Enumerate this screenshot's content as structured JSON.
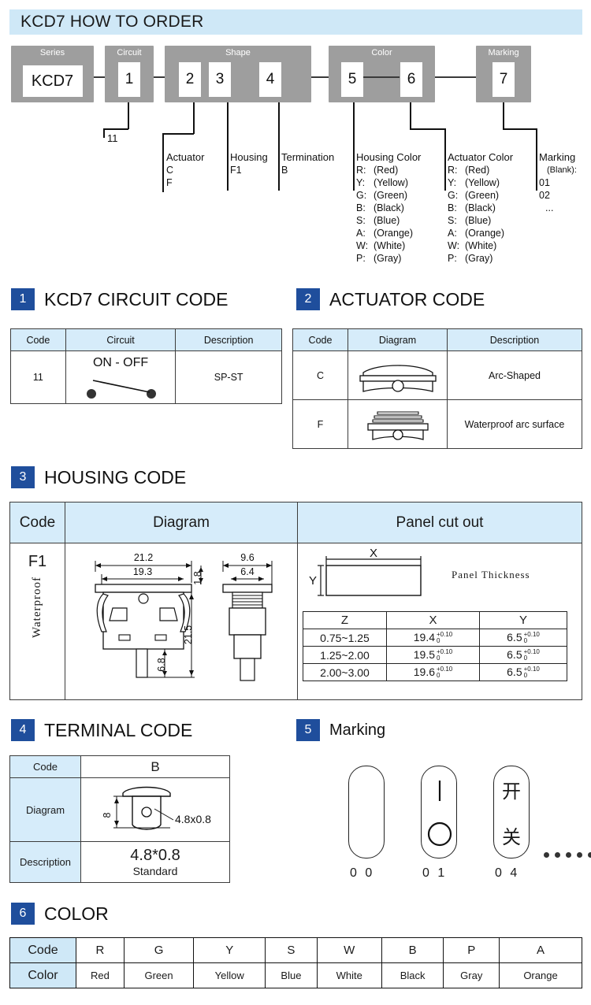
{
  "header": {
    "title": "KCD7 HOW TO ORDER"
  },
  "order_diagram": {
    "groups": [
      {
        "label": "Series",
        "cells": [
          "KCD7"
        ]
      },
      {
        "label": "Circuit",
        "cells": [
          "1"
        ]
      },
      {
        "label": "Shape",
        "cells": [
          "2",
          "3",
          "4"
        ]
      },
      {
        "label": "Color",
        "cells": [
          "5",
          "6"
        ]
      },
      {
        "label": "Marking",
        "cells": [
          "7"
        ]
      }
    ]
  },
  "legend": {
    "circuit": {
      "title": "",
      "value": "11"
    },
    "actuator": {
      "title": "Actuator",
      "items": [
        "C",
        "F"
      ]
    },
    "housing": {
      "title": "Housing",
      "items": [
        "F1"
      ]
    },
    "termination": {
      "title": "Termination",
      "items": [
        "B"
      ]
    },
    "housing_color": {
      "title": "Housing Color",
      "items": [
        {
          "code": "R:",
          "name": "(Red)"
        },
        {
          "code": "Y:",
          "name": "(Yellow)"
        },
        {
          "code": "G:",
          "name": "(Green)"
        },
        {
          "code": "B:",
          "name": "(Black)"
        },
        {
          "code": "S:",
          "name": "(Blue)"
        },
        {
          "code": "A:",
          "name": "(Orange)"
        },
        {
          "code": "W:",
          "name": "(White)"
        },
        {
          "code": "P:",
          "name": "(Gray)"
        }
      ]
    },
    "actuator_color": {
      "title": "Actuator Color",
      "items": [
        {
          "code": "R:",
          "name": "(Red)"
        },
        {
          "code": "Y:",
          "name": "(Yellow)"
        },
        {
          "code": "G:",
          "name": "(Green)"
        },
        {
          "code": "B:",
          "name": "(Black)"
        },
        {
          "code": "S:",
          "name": "(Blue)"
        },
        {
          "code": "A:",
          "name": "(Orange)"
        },
        {
          "code": "W:",
          "name": "(White)"
        },
        {
          "code": "P:",
          "name": "(Gray)"
        }
      ]
    },
    "marking": {
      "title": "Marking",
      "blank": "(Blank):",
      "items": [
        "01",
        "02",
        "..."
      ]
    }
  },
  "sections": {
    "circuit_code": {
      "number": "1",
      "title": "KCD7 CIRCUIT CODE",
      "headers": [
        "Code",
        "Circuit",
        "Description"
      ],
      "rows": [
        {
          "code": "11",
          "circuit_label": "ON - OFF",
          "description": "SP-ST"
        }
      ]
    },
    "actuator_code": {
      "number": "2",
      "title": "ACTUATOR CODE",
      "headers": [
        "Code",
        "Diagram",
        "Description"
      ],
      "rows": [
        {
          "code": "C",
          "description": "Arc-Shaped"
        },
        {
          "code": "F",
          "description": "Waterproof arc surface"
        }
      ]
    },
    "housing_code": {
      "number": "3",
      "title": "HOUSING CODE",
      "headers": [
        "Code",
        "Diagram",
        "Panel cut out"
      ],
      "code": "F1",
      "code_note": "Waterproof",
      "dimensions": {
        "width_outer": "21.2",
        "width_inner": "19.3",
        "flange_thickness": "1.8",
        "height": "21.5",
        "terminal_length": "6.8",
        "side_outer": "9.6",
        "side_inner": "6.4"
      },
      "cutout": {
        "x_label": "X",
        "y_label": "Y",
        "note": "Panel Thickness",
        "headers": [
          "Z",
          "X",
          "Y"
        ],
        "rows": [
          {
            "z": "0.75~1.25",
            "x": "19.4",
            "x_tol_up": "+0.10",
            "x_tol_dn": "0",
            "y": "6.5",
            "y_tol_up": "+0.10",
            "y_tol_dn": "0"
          },
          {
            "z": "1.25~2.00",
            "x": "19.5",
            "x_tol_up": "+0.10",
            "x_tol_dn": "0",
            "y": "6.5",
            "y_tol_up": "+0.10",
            "y_tol_dn": "0"
          },
          {
            "z": "2.00~3.00",
            "x": "19.6",
            "x_tol_up": "+0.10",
            "x_tol_dn": "0",
            "y": "6.5",
            "y_tol_up": "+0.10",
            "y_tol_dn": "0"
          }
        ]
      }
    },
    "terminal_code": {
      "number": "4",
      "title": "TERMINAL CODE",
      "code_label": "Code",
      "code_value": "B",
      "diagram_label": "Diagram",
      "diagram_height": "8",
      "diagram_callout": "4.8x0.8",
      "description_label": "Description",
      "description_value": "4.8*0.8",
      "description_sub": "Standard"
    },
    "marking": {
      "number": "5",
      "title": "Marking",
      "items": [
        {
          "caption": "0 0",
          "symbol": "blank"
        },
        {
          "caption": "0 1",
          "symbol": "bar-circle"
        },
        {
          "caption": "0 4",
          "symbol": "kai-guan"
        }
      ],
      "symbol_chars": {
        "kai": "开",
        "guan": "关"
      },
      "more_dots": 6
    },
    "color": {
      "number": "6",
      "title": "COLOR",
      "row_labels": [
        "Code",
        "Color"
      ],
      "codes": [
        "R",
        "G",
        "Y",
        "S",
        "W",
        "B",
        "P",
        "A"
      ],
      "colors": [
        "Red",
        "Green",
        "Yellow",
        "Blue",
        "White",
        "Black",
        "Gray",
        "Orange"
      ]
    }
  },
  "theme": {
    "header_band": "#cfe8f7",
    "badge_blue": "#1f4e9c",
    "table_head": "#d6ecfa",
    "group_gray": "#9e9e9e"
  }
}
